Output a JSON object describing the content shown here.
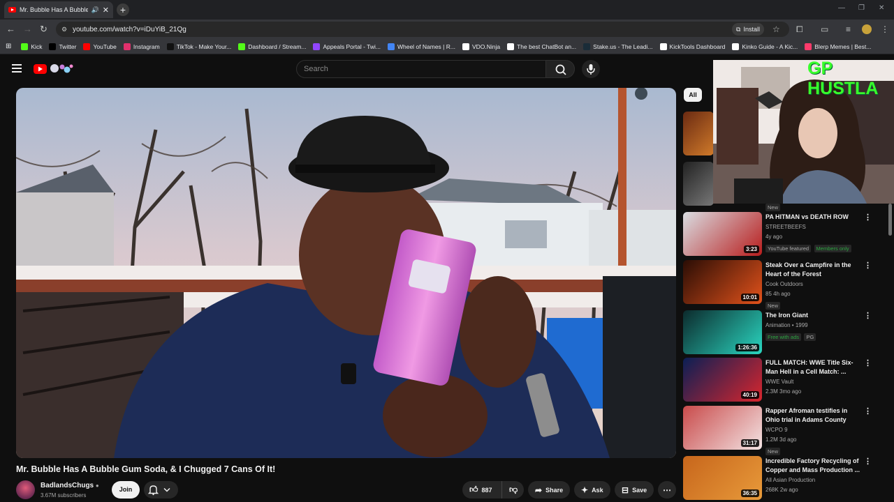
{
  "browser": {
    "tab_title": "Mr. Bubble Has A Bubble G",
    "url": "youtube.com/watch?v=iDuYiB_21Qg",
    "install_label": "Install",
    "bookmarks": [
      {
        "label": "Kick",
        "color": "#53fc18"
      },
      {
        "label": "Twitter",
        "color": "#000000"
      },
      {
        "label": "YouTube",
        "color": "#ff0000"
      },
      {
        "label": "Instagram",
        "color": "#e1306c"
      },
      {
        "label": "TikTok - Make Your...",
        "color": "#111111"
      },
      {
        "label": "Dashboard / Stream...",
        "color": "#53fc18"
      },
      {
        "label": "Appeals Portal - Twi...",
        "color": "#9146ff"
      },
      {
        "label": "Wheel of Names | R...",
        "color": "#4285f4"
      },
      {
        "label": "VDO.Ninja",
        "color": "#ffffff"
      },
      {
        "label": "The best ChatBot an...",
        "color": "#ffffff"
      },
      {
        "label": "Stake.us - The Leadi...",
        "color": "#1a2c38"
      },
      {
        "label": "KickTools Dashboard",
        "color": "#ffffff"
      },
      {
        "label": "Kinko Guide - A Kic...",
        "color": "#ffffff"
      },
      {
        "label": "Blerp Memes | Best...",
        "color": "#ff3b6b"
      }
    ]
  },
  "header": {
    "search_placeholder": "Search"
  },
  "video": {
    "title": "Mr. Bubble Has A Bubble Gum Soda, & I Chugged 7 Cans Of It!",
    "channel": "BadlandsChugs",
    "subscribers": "3.67M subscribers",
    "join_label": "Join",
    "likes": "887",
    "share_label": "Share",
    "ask_label": "Ask",
    "save_label": "Save"
  },
  "sidebar": {
    "chip_all": "All",
    "partial_new_badge": "New",
    "items": [
      {
        "title": "PA HITMAN vs DEATH ROW",
        "channel": "STREETBEEFS",
        "stats": "4y ago",
        "badge": "YouTube featured",
        "badge2": "Members only",
        "duration": "3:23",
        "colors": [
          "#d9dde2",
          "#b81d1d"
        ]
      },
      {
        "title": "Steak Over a Campfire in the Heart of the Forest",
        "channel": "Cook Outdoors",
        "stats": "85  4h ago",
        "badge": "New",
        "duration": "10:01",
        "colors": [
          "#2a0d05",
          "#e2521b"
        ]
      },
      {
        "title": "The Iron Giant",
        "channel": "Animation • 1999",
        "badge": "Free with ads",
        "badge2": "PG",
        "duration": "1:26:36",
        "colors": [
          "#0c2a2c",
          "#2ad6c0"
        ]
      },
      {
        "title": "FULL MATCH: WWE Title Six-Man Hell in a Cell Match: ...",
        "channel": "WWE Vault",
        "stats": "2.3M  3mo ago",
        "duration": "40:19",
        "colors": [
          "#0a1f55",
          "#d8262e"
        ]
      },
      {
        "title": "Rapper Afroman testifies in Ohio trial in Adams County",
        "channel": "WCPO 9",
        "stats": "1.2M  3d ago",
        "badge": "New",
        "duration": "31:17",
        "colors": [
          "#c94b4b",
          "#f3e3e3"
        ]
      },
      {
        "title": "Incredible Factory Recycling of Copper and Mass Production ...",
        "channel": "All Asian Production",
        "stats": "268K  2w ago",
        "duration": "36:35",
        "colors": [
          "#c7661c",
          "#e89a3a"
        ]
      }
    ]
  },
  "overlay": {
    "text": "GP HUSTLA"
  }
}
